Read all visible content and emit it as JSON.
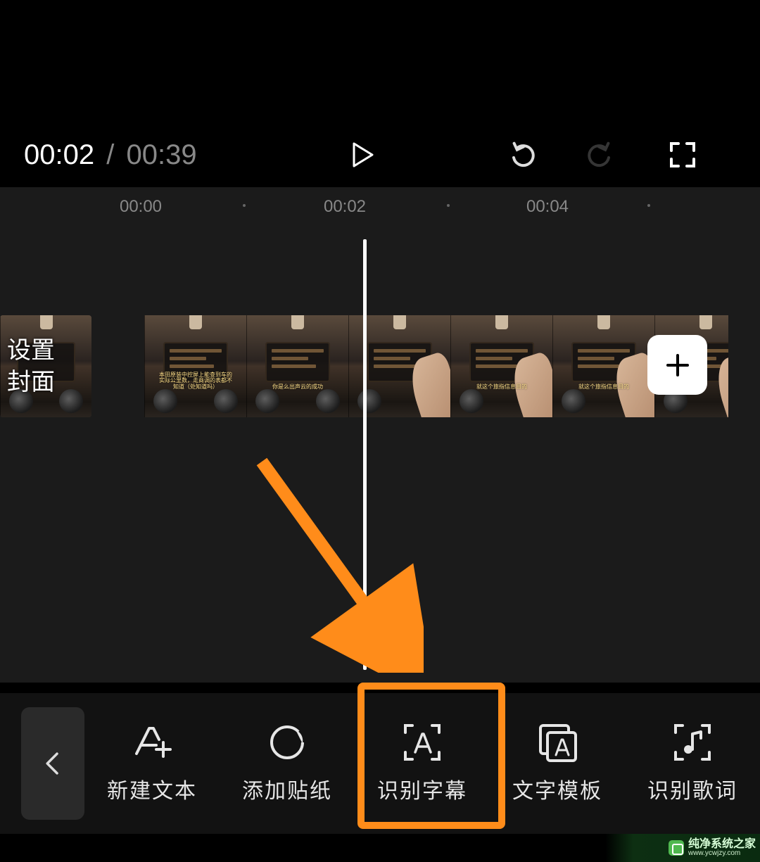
{
  "playback": {
    "current_time": "00:02",
    "total_time": "00:39",
    "separator": "/"
  },
  "ruler": {
    "labels": [
      "00:00",
      "00:02",
      "00:04"
    ],
    "label_positions": [
      200,
      490,
      778
    ],
    "dot_positions": [
      345,
      635,
      920
    ]
  },
  "cover": {
    "line1": "设置",
    "line2": "封面"
  },
  "toolbar": {
    "new_text": "新建文本",
    "add_sticker": "添加贴纸",
    "recognize_subtitles": "识别字幕",
    "text_template": "文字模板",
    "recognize_lyrics": "识别歌词"
  },
  "watermark": {
    "title": "纯净系统之家",
    "url": "www.ycwjzy.com"
  }
}
